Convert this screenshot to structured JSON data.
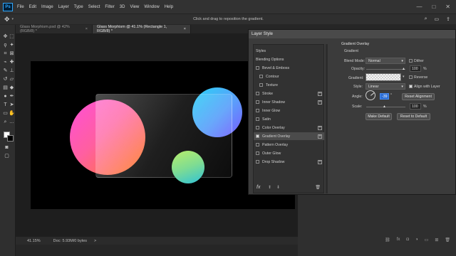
{
  "app": {
    "logo": "Ps",
    "menu": [
      "File",
      "Edit",
      "Image",
      "Layer",
      "Type",
      "Select",
      "Filter",
      "3D",
      "View",
      "Window",
      "Help"
    ],
    "window_controls": [
      "—",
      "□",
      "✕"
    ]
  },
  "options_bar": {
    "hint": "Click and drag to reposition the gradient."
  },
  "tabs": [
    {
      "label": "Glass Morphism.psd @ 42% (RGB/8) *",
      "close": "×"
    },
    {
      "label": "Glass Morphism @ 41.1% (Rectangle 1, RGB/8) *",
      "close": "×"
    }
  ],
  "status": {
    "zoom": "41.15%",
    "doc": "Doc: 5.93M/0 bytes",
    "arrow": ">"
  },
  "dialog": {
    "title": "Layer Style",
    "styles_header": "Styles",
    "items": [
      {
        "label": "Blending Options"
      },
      {
        "label": "Bevel & Emboss"
      },
      {
        "label": "Contour"
      },
      {
        "label": "Texture"
      },
      {
        "label": "Stroke"
      },
      {
        "label": "Inner Shadow"
      },
      {
        "label": "Inner Glow"
      },
      {
        "label": "Satin"
      },
      {
        "label": "Color Overlay"
      },
      {
        "label": "Gradient Overlay"
      },
      {
        "label": "Pattern Overlay"
      },
      {
        "label": "Outer Glow"
      },
      {
        "label": "Drop Shadow"
      }
    ],
    "fx_label": "fx",
    "gradient_overlay": {
      "section_title": "Gradient Overlay",
      "sub_title": "Gradient",
      "blend_mode_label": "Blend Mode:",
      "blend_mode_value": "Normal",
      "dither_label": "Dither",
      "opacity_label": "Opacity:",
      "opacity_value": "100",
      "percent": "%",
      "gradient_label": "Gradient:",
      "reverse_label": "Reverse",
      "style_label": "Style:",
      "style_value": "Linear",
      "align_label": "Align with Layer",
      "angle_label": "Angle:",
      "angle_value": "-39",
      "degree": "°",
      "reset_alignment": "Reset Alignment",
      "scale_label": "Scale:",
      "scale_value": "100",
      "make_default": "Make Default",
      "reset_default": "Reset to Default"
    }
  },
  "colors": {
    "pink_orange_top": "#ff4fd8",
    "pink_orange_bottom": "#ff7a1a",
    "cyan": "#29d3f5",
    "violet": "#7a5cff",
    "green": "#a8e86a",
    "teal": "#2fc2d8",
    "photoshop_blue": "#31a8ff"
  }
}
